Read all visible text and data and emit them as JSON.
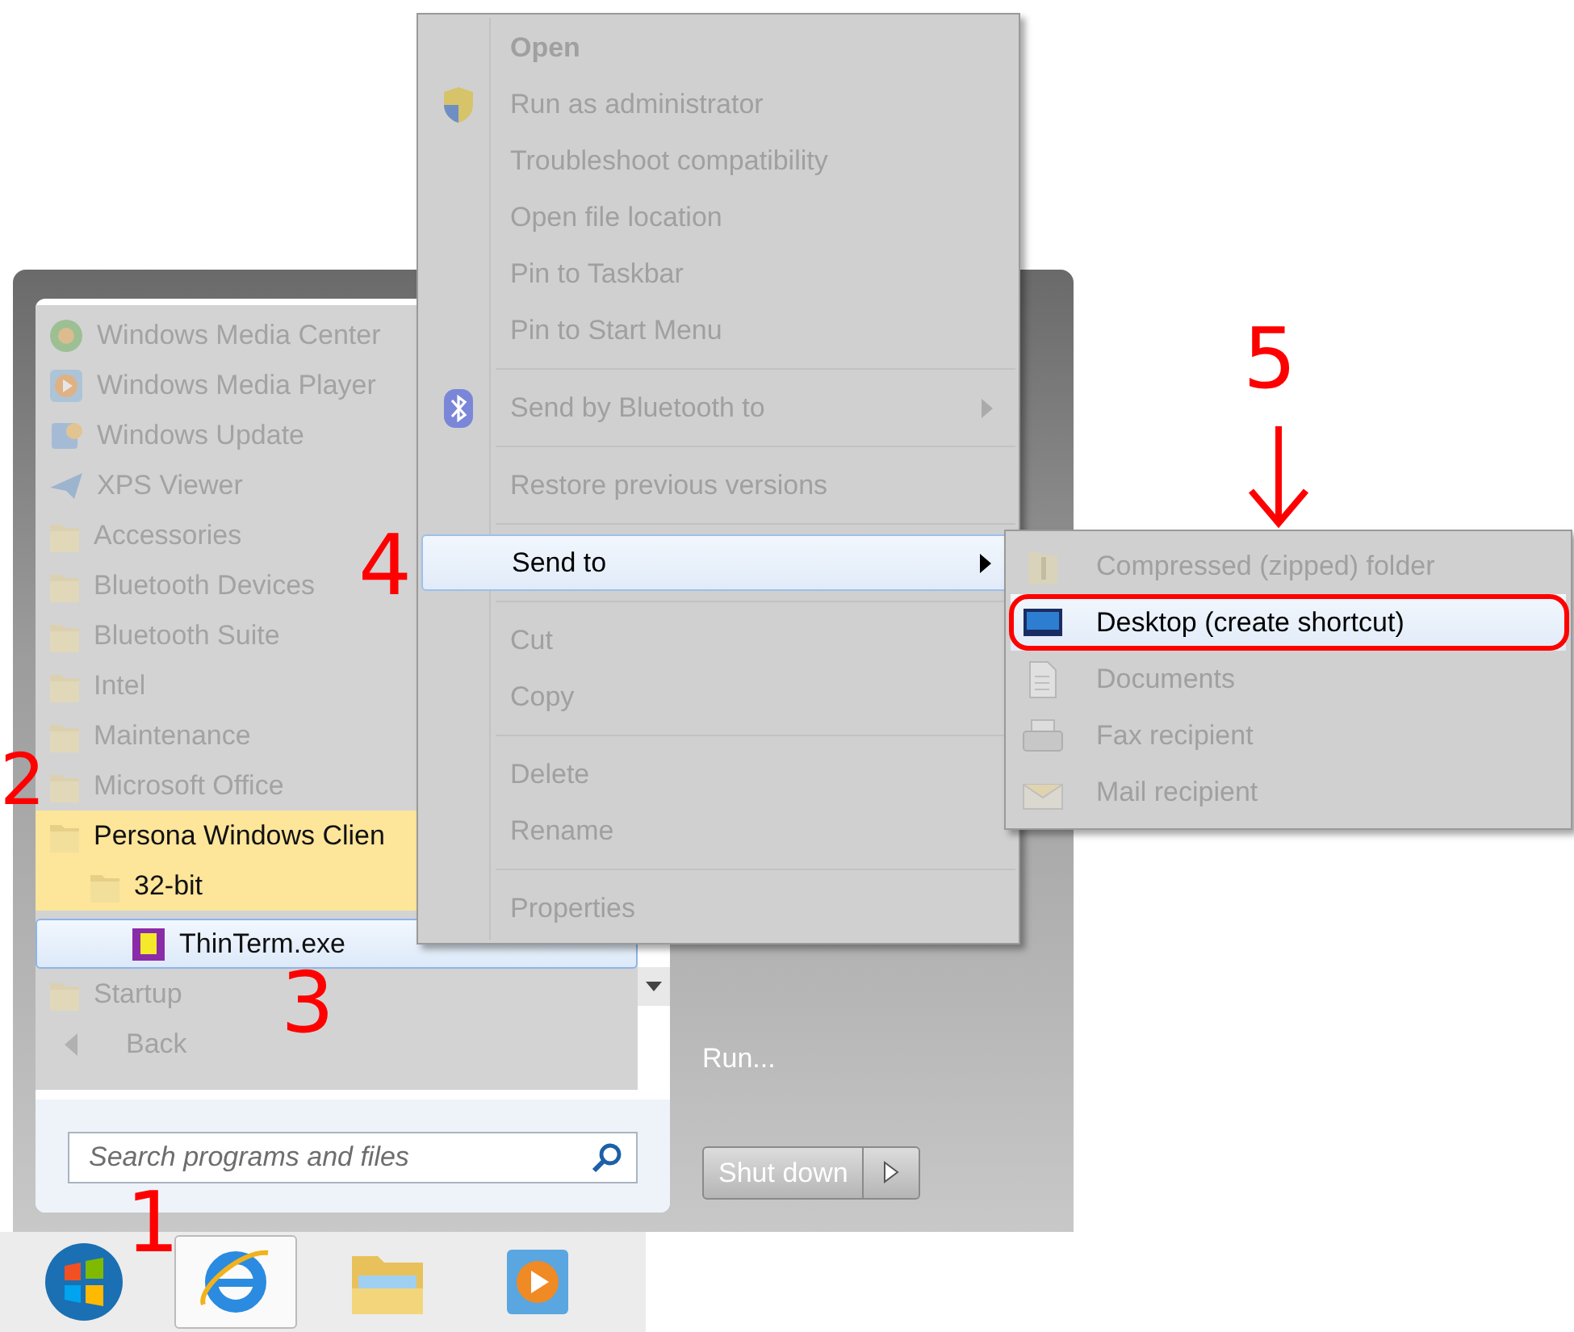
{
  "start_menu": {
    "programs": [
      {
        "kind": "media-center",
        "label": "Windows Media Center",
        "dimmed": true,
        "selected": false,
        "expanded": false
      },
      {
        "kind": "media-player",
        "label": "Windows Media Player",
        "dimmed": true,
        "selected": false,
        "expanded": false
      },
      {
        "kind": "update",
        "label": "Windows Update",
        "dimmed": true,
        "selected": false,
        "expanded": false
      },
      {
        "kind": "viewer",
        "label": "XPS Viewer",
        "dimmed": true,
        "selected": false,
        "expanded": false
      },
      {
        "kind": "folder",
        "label": "Accessories",
        "dimmed": true,
        "selected": false,
        "expanded": false
      },
      {
        "kind": "folder",
        "label": "Bluetooth Devices",
        "dimmed": true,
        "selected": false,
        "expanded": false
      },
      {
        "kind": "folder",
        "label": "Bluetooth Suite",
        "dimmed": true,
        "selected": false,
        "expanded": false
      },
      {
        "kind": "folder",
        "label": "Intel",
        "dimmed": true,
        "selected": false,
        "expanded": false
      },
      {
        "kind": "folder",
        "label": "Maintenance",
        "dimmed": true,
        "selected": false,
        "expanded": false
      },
      {
        "kind": "folder",
        "label": "Microsoft Office",
        "dimmed": true,
        "selected": false,
        "expanded": false
      },
      {
        "kind": "folder",
        "label": "Persona Windows Clien",
        "dimmed": false,
        "selected": false,
        "expanded": true,
        "children": [
          {
            "kind": "folder",
            "label": "32-bit",
            "dimmed": false,
            "selected": false,
            "expanded": true,
            "children": [
              {
                "kind": "app",
                "label": "ThinTerm.exe",
                "dimmed": false,
                "selected": true,
                "expanded": false
              }
            ]
          }
        ]
      },
      {
        "kind": "folder",
        "label": "Startup",
        "dimmed": true,
        "selected": false,
        "expanded": false
      },
      {
        "kind": "back",
        "label": "Back",
        "dimmed": true,
        "selected": false,
        "expanded": false
      }
    ],
    "search": {
      "placeholder": "Search programs and files"
    },
    "right_pane": {
      "items": [
        {
          "label": "Run..."
        }
      ]
    },
    "shutdown": {
      "label": "Shut down"
    }
  },
  "taskbar": [
    {
      "kind": "start",
      "active": false
    },
    {
      "kind": "browser",
      "active": true
    },
    {
      "kind": "folder",
      "active": false
    },
    {
      "kind": "media-player",
      "active": false
    }
  ],
  "context_menu": {
    "items": [
      {
        "kind": "item",
        "label": "Open",
        "default": true,
        "disabled": true,
        "selected": false,
        "has_submenu": false
      },
      {
        "kind": "item",
        "label": "Run as administrator",
        "default": false,
        "disabled": true,
        "selected": false,
        "has_submenu": false
      },
      {
        "kind": "item",
        "label": "Troubleshoot compatibility",
        "default": false,
        "disabled": true,
        "selected": false,
        "has_submenu": false
      },
      {
        "kind": "item",
        "label": "Open file location",
        "default": false,
        "disabled": true,
        "selected": false,
        "has_submenu": false
      },
      {
        "kind": "item",
        "label": "Pin to Taskbar",
        "default": false,
        "disabled": true,
        "selected": false,
        "has_submenu": false
      },
      {
        "kind": "item",
        "label": "Pin to Start Menu",
        "default": false,
        "disabled": true,
        "selected": false,
        "has_submenu": false
      },
      {
        "kind": "separator"
      },
      {
        "kind": "item",
        "label": "Send by Bluetooth to",
        "default": false,
        "disabled": true,
        "selected": false,
        "has_submenu": true
      },
      {
        "kind": "separator"
      },
      {
        "kind": "item",
        "label": "Restore previous versions",
        "default": false,
        "disabled": true,
        "selected": false,
        "has_submenu": false
      },
      {
        "kind": "separator"
      },
      {
        "kind": "item",
        "label": "Send to",
        "default": false,
        "disabled": false,
        "selected": true,
        "has_submenu": true
      },
      {
        "kind": "separator"
      },
      {
        "kind": "item",
        "label": "Cut",
        "default": false,
        "disabled": true,
        "selected": false,
        "has_submenu": false
      },
      {
        "kind": "item",
        "label": "Copy",
        "default": false,
        "disabled": true,
        "selected": false,
        "has_submenu": false
      },
      {
        "kind": "separator"
      },
      {
        "kind": "item",
        "label": "Delete",
        "default": false,
        "disabled": true,
        "selected": false,
        "has_submenu": false
      },
      {
        "kind": "item",
        "label": "Rename",
        "default": false,
        "disabled": true,
        "selected": false,
        "has_submenu": false
      },
      {
        "kind": "separator"
      },
      {
        "kind": "item",
        "label": "Properties",
        "default": false,
        "disabled": true,
        "selected": false,
        "has_submenu": false
      }
    ]
  },
  "send_to_menu": {
    "items": [
      {
        "kind": "zip",
        "label": "Compressed (zipped) folder",
        "disabled": true,
        "selected": false
      },
      {
        "kind": "desktop",
        "label": "Desktop (create shortcut)",
        "disabled": false,
        "selected": true
      },
      {
        "kind": "document",
        "label": "Documents",
        "disabled": true,
        "selected": false
      },
      {
        "kind": "fax",
        "label": "Fax recipient",
        "disabled": true,
        "selected": false
      },
      {
        "kind": "mail",
        "label": "Mail recipient",
        "disabled": true,
        "selected": false
      }
    ]
  },
  "annotations": [
    {
      "kind": "number",
      "text": "1"
    },
    {
      "kind": "number",
      "text": "2"
    },
    {
      "kind": "number",
      "text": "3"
    },
    {
      "kind": "number",
      "text": "4"
    },
    {
      "kind": "number",
      "text": "5"
    },
    {
      "kind": "arrow"
    },
    {
      "kind": "ring"
    }
  ]
}
